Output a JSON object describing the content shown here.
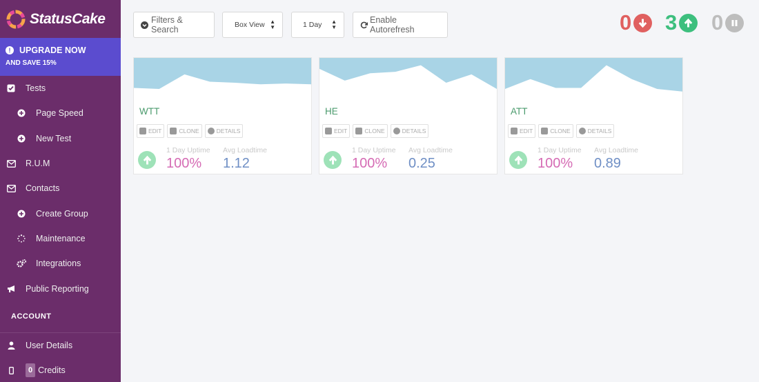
{
  "app": {
    "name": "StatusCake"
  },
  "upgrade": {
    "title": "UPGRADE NOW",
    "subtitle": "AND SAVE 15%"
  },
  "nav": {
    "tests": "Tests",
    "page_speed": "Page Speed",
    "new_test": "New Test",
    "rum": "R.U.M",
    "contacts": "Contacts",
    "create_group": "Create Group",
    "maintenance": "Maintenance",
    "integrations": "Integrations",
    "public_reporting": "Public Reporting",
    "account_header": "ACCOUNT",
    "user_details": "User Details",
    "credits_count": "0",
    "credits": "Credits"
  },
  "toolbar": {
    "filters": "Filters & Search",
    "view": "Box View",
    "period": "1 Day",
    "autorefresh": "Enable Autorefresh"
  },
  "counters": {
    "down": "0",
    "up": "3",
    "paused": "0"
  },
  "colors": {
    "sidebar": "#6b2d6a",
    "upgrade": "#5b4ccf",
    "down": "#e06060",
    "up": "#3dbf7e",
    "paused": "#bdbdbd"
  },
  "card_labels": {
    "edit": "EDIT",
    "clone": "CLONE",
    "details": "DETAILS",
    "uptime_label": "1 Day Uptime",
    "loadtime_label": "Avg Loadtime"
  },
  "tests": [
    {
      "name": "WTT",
      "uptime": "100%",
      "loadtime": "1.12",
      "spark": [
        0.82,
        0.85,
        0.45,
        0.65,
        0.68,
        0.72,
        0.7,
        0.72
      ]
    },
    {
      "name": "HE",
      "uptime": "100%",
      "loadtime": "0.25",
      "spark": [
        0.3,
        0.62,
        0.42,
        0.38,
        0.2,
        0.68,
        0.45,
        0.85
      ]
    },
    {
      "name": "ATT",
      "uptime": "100%",
      "loadtime": "0.89",
      "spark": [
        0.85,
        0.58,
        0.82,
        0.82,
        0.2,
        0.58,
        0.85,
        0.92
      ]
    }
  ]
}
